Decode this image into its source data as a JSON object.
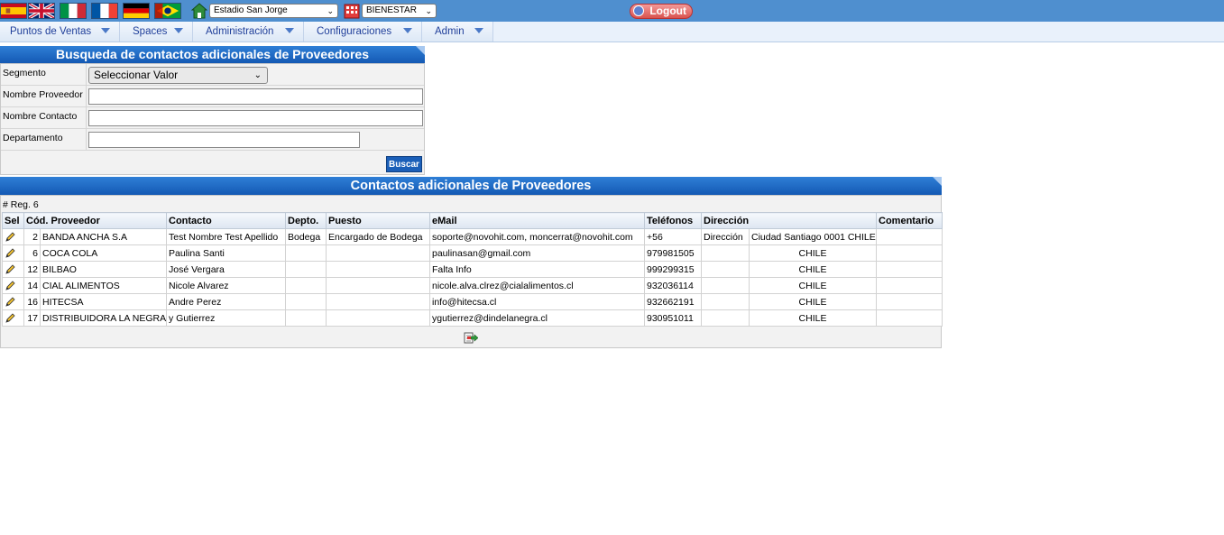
{
  "topbar": {
    "flags": [
      {
        "name": "spain-flag-icon",
        "color": "#c60b1e"
      },
      {
        "name": "uk-flag-icon",
        "color": "#012169"
      },
      {
        "name": "italy-flag-icon",
        "color": "#009246"
      },
      {
        "name": "france-flag-icon",
        "color": "#0055a4"
      },
      {
        "name": "germany-flag-icon",
        "color": "#dd0000"
      },
      {
        "name": "portugal-flag-icon",
        "color": "#006600"
      }
    ],
    "site_select": "Estadio San Jorge",
    "company_select": "BIENESTAR",
    "logout_label": "Logout"
  },
  "menu": {
    "items": [
      "Puntos de Ventas",
      "Spaces",
      "Administración",
      "Configuraciones",
      "Admin"
    ]
  },
  "search": {
    "title": "Busqueda de contactos adicionales de Proveedores",
    "segment_label": "Segmento",
    "segment_value": "Seleccionar Valor",
    "provider_label": "Nombre Proveedor",
    "provider_value": "",
    "contact_label": "Nombre Contacto",
    "contact_value": "",
    "department_label": "Departamento",
    "department_value": "",
    "button_label": "Buscar"
  },
  "results": {
    "title": "Contactos adicionales de Proveedores",
    "reg_count": "# Reg. 6",
    "headers": [
      "Sel",
      "Cód. Proveedor",
      "Contacto",
      "Depto.",
      "Puesto",
      "eMail",
      "Teléfonos",
      "Dirección",
      "Comentario"
    ],
    "rows": [
      {
        "cod": "2",
        "proveedor": "BANDA ANCHA S.A",
        "contacto": "Test Nombre Test Apellido",
        "depto": "Bodega",
        "puesto": "Encargado de Bodega",
        "email": "soporte@novohit.com, moncerrat@novohit.com",
        "telefono": "+56",
        "direccion": "Dirección",
        "ciudad": "Ciudad Santiago 0001 CHILE",
        "comentario": ""
      },
      {
        "cod": "6",
        "proveedor": "COCA COLA",
        "contacto": "Paulina Santi",
        "depto": "",
        "puesto": "",
        "email": "paulinasan@gmail.com",
        "telefono": "979981505",
        "direccion": "",
        "ciudad": "CHILE",
        "comentario": ""
      },
      {
        "cod": "12",
        "proveedor": "BILBAO",
        "contacto": "José Vergara",
        "depto": "",
        "puesto": "",
        "email": "Falta Info",
        "telefono": "999299315",
        "direccion": "",
        "ciudad": "CHILE",
        "comentario": ""
      },
      {
        "cod": "14",
        "proveedor": "CIAL ALIMENTOS",
        "contacto": "Nicole Alvarez",
        "depto": "",
        "puesto": "",
        "email": "nicole.alva.clrez@cialalimentos.cl",
        "telefono": "932036114",
        "direccion": "",
        "ciudad": "CHILE",
        "comentario": ""
      },
      {
        "cod": "16",
        "proveedor": "HITECSA",
        "contacto": "Andre Perez",
        "depto": "",
        "puesto": "",
        "email": "info@hitecsa.cl",
        "telefono": "932662191",
        "direccion": "",
        "ciudad": "CHILE",
        "comentario": ""
      },
      {
        "cod": "17",
        "proveedor": "DISTRIBUIDORA LA NEGRA",
        "contacto": "y Gutierrez",
        "depto": "",
        "puesto": "",
        "email": "ygutierrez@dindelanegra.cl",
        "telefono": "930951011",
        "direccion": "",
        "ciudad": "CHILE",
        "comentario": ""
      }
    ]
  },
  "colors": {
    "topbar": "#4f8fcf",
    "panel_header": "#1b66c4",
    "button": "#1b5fb8",
    "logout": "#d9534f"
  }
}
